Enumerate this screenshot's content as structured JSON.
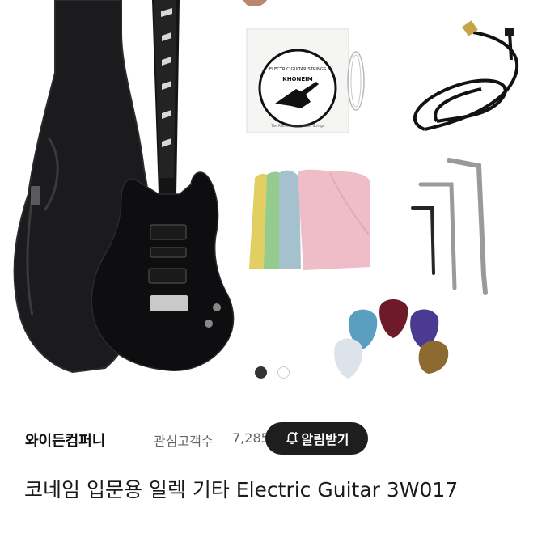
{
  "product_image": {
    "strings_package": {
      "header": "ELECTRIC GUITAR STRINGS",
      "brand": "KHONEIM",
      "footer": "The Round Wound Guitar Strings"
    }
  },
  "carousel": {
    "total": 2,
    "active_index": 0
  },
  "shop": {
    "name": "와이든컴퍼니",
    "follower_label": "관심고객수",
    "follower_count": "7,285",
    "alert_button_label": "알림받기"
  },
  "product": {
    "title": "코네임 입문용 일렉 기타 Electric Guitar 3W017"
  }
}
